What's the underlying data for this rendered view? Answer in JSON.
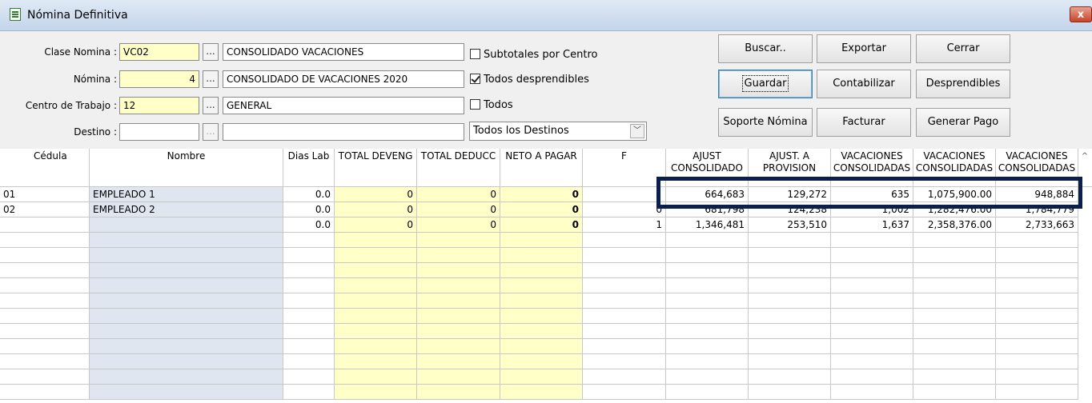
{
  "window": {
    "title": "Nómina Definitiva",
    "close_label": "x"
  },
  "form": {
    "clase_label": "Clase Nomina :",
    "clase_code": "VC02",
    "clase_desc": "CONSOLIDADO VACACIONES",
    "nomina_label": "Nómina :",
    "nomina_num": "4",
    "nomina_desc": "CONSOLIDADO DE VACACIONES 2020",
    "centro_label": "Centro de Trabajo :",
    "centro_code": "12",
    "centro_desc": "GENERAL",
    "destino_label": "Destino :",
    "destino_code": "",
    "destino_desc": "",
    "dots": "...",
    "subtotales_label": "Subtotales por Centro",
    "desprendibles_label": "Todos desprendibles",
    "todos_label": "Todos",
    "destinos_select": "Todos los Destinos",
    "select_arrow": "﹀"
  },
  "buttons": {
    "buscar": "Buscar..",
    "exportar": "Exportar",
    "cerrar": "Cerrar",
    "guardar": "Guardar",
    "contabilizar": "Contabilizar",
    "desprendibles": "Desprendibles",
    "soporte": "Soporte Nómina",
    "facturar": "Facturar",
    "generar": "Generar Pago"
  },
  "grid": {
    "headers": {
      "cedula": "Cédula",
      "nombre": "Nombre",
      "dias": "Dias Lab",
      "devengado": "TOTAL DEVENG",
      "deducciones": "TOTAL DEDUCC",
      "neto": "NETO A PAGAR",
      "f": "F",
      "ajust1_a": "AJUST",
      "ajust1_b": "CONSOLIDADO",
      "ajust2_a": "AJUST. A",
      "ajust2_b": "PROVISION",
      "vac1_a": "VACACIONES",
      "vac1_b": "CONSOLIDADAS",
      "vac2_a": "VACACIONES",
      "vac2_b": "CONSOLIDADAS",
      "vac3_a": "VACACIONES",
      "vac3_b": "CONSOLIDADAS",
      "scroll_up": "^"
    },
    "rows": [
      {
        "cedula": "01",
        "nombre": "EMPLEADO 1",
        "dias": "0.0",
        "dev": "0",
        "ded": "0",
        "neto": "0",
        "f": "",
        "ajust": "664,683",
        "prov": "129,272",
        "vac1": "635",
        "vac2": "1,075,900.00",
        "vac3": "948,884"
      },
      {
        "cedula": "02",
        "nombre": "EMPLEADO 2",
        "dias": "0.0",
        "dev": "0",
        "ded": "0",
        "neto": "0",
        "f": "0",
        "ajust": "681,798",
        "prov": "124,238",
        "vac1": "1,002",
        "vac2": "1,282,476.00",
        "vac3": "1,784,779"
      },
      {
        "cedula": "",
        "nombre": "",
        "dias": "0.0",
        "dev": "0",
        "ded": "0",
        "neto": "0",
        "f": "1",
        "ajust": "1,346,481",
        "prov": "253,510",
        "vac1": "1,637",
        "vac2": "2,358,376.00",
        "vac3": "2,733,663"
      }
    ]
  }
}
